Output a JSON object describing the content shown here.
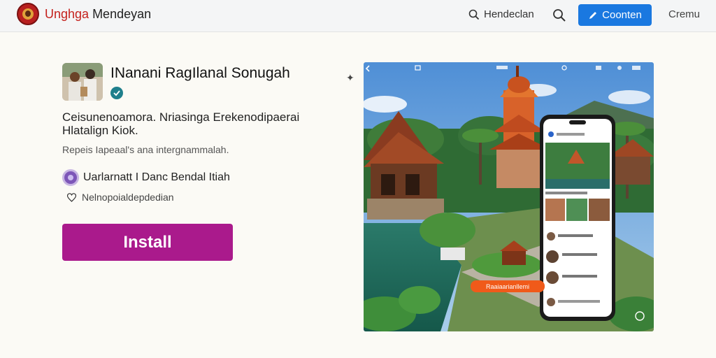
{
  "header": {
    "brand_accent": "Unghga",
    "brand_rest": " Mendeyan",
    "search_label": "Hendeclan",
    "cta_label": "Coonten",
    "nav_link": "Cremu",
    "colors": {
      "cta": "#1a78e0",
      "brand_accent": "#c4211c"
    }
  },
  "app": {
    "title": "INanani RagIlanal Sonugah",
    "description": "Ceisunenoamora. Nriasinga Erekenodipaerai Hlatalign Kiok.",
    "subdescription": "Repeis Iapeaal's ana intergnammalah.",
    "developer": "Uarlarnatt I Danc Bendal Itiah",
    "meta": "Nelnopoialdepdedian",
    "install_label": "Install",
    "install_color": "#aa1a8c"
  },
  "hero": {
    "banner_label": "Raaiaarianllemi",
    "icons": [
      "back-icon",
      "wifi-icon",
      "clock-icon",
      "signal-icon",
      "battery-icon"
    ]
  }
}
